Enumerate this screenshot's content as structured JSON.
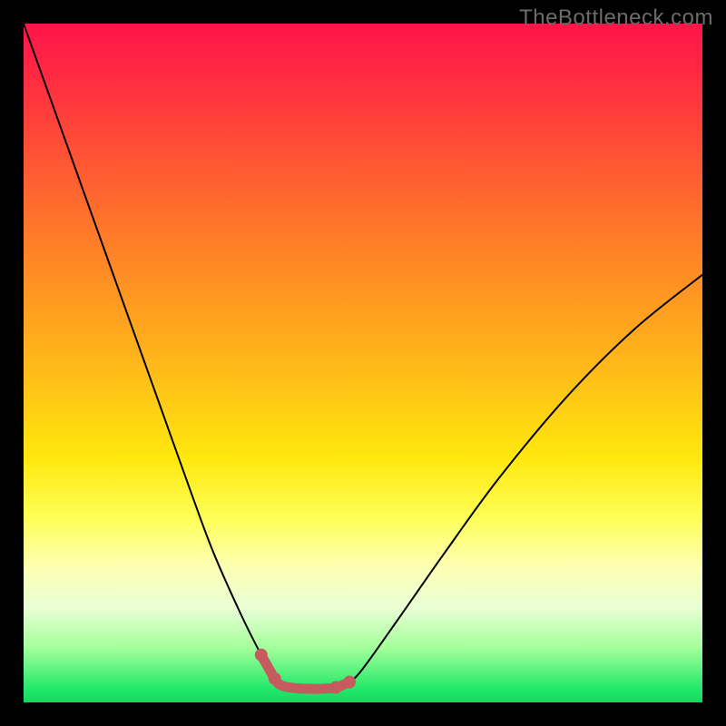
{
  "watermark": "TheBottleneck.com",
  "chart_data": {
    "type": "line",
    "title": "",
    "xlabel": "",
    "ylabel": "",
    "xlim": [
      0,
      100
    ],
    "ylim": [
      0,
      100
    ],
    "grid": false,
    "legend": false,
    "series": [
      {
        "name": "bottleneck-curve",
        "x": [
          0,
          5,
          10,
          15,
          20,
          25,
          28,
          32,
          35,
          37,
          38,
          40,
          42,
          44,
          46,
          48,
          50,
          55,
          62,
          70,
          80,
          90,
          100
        ],
        "y": [
          100,
          86,
          72,
          58,
          44,
          30,
          22,
          13,
          7,
          3.5,
          2.5,
          2.1,
          2.0,
          2.0,
          2.2,
          3.0,
          5,
          12,
          22,
          33,
          45,
          55,
          63
        ]
      }
    ],
    "valley_highlight": {
      "color": "#c55a5f",
      "x": [
        35,
        37,
        38,
        40,
        42,
        44,
        46,
        48
      ],
      "y": [
        7,
        3.5,
        2.5,
        2.1,
        2.0,
        2.0,
        2.2,
        3.0
      ],
      "dots_x": [
        35,
        37,
        46,
        48
      ],
      "dots_y": [
        7,
        3.5,
        2.2,
        3.0
      ]
    },
    "background_gradient": {
      "top": "#ff144a",
      "mid": "#ffe80e",
      "bottom": "#15d85f"
    }
  }
}
